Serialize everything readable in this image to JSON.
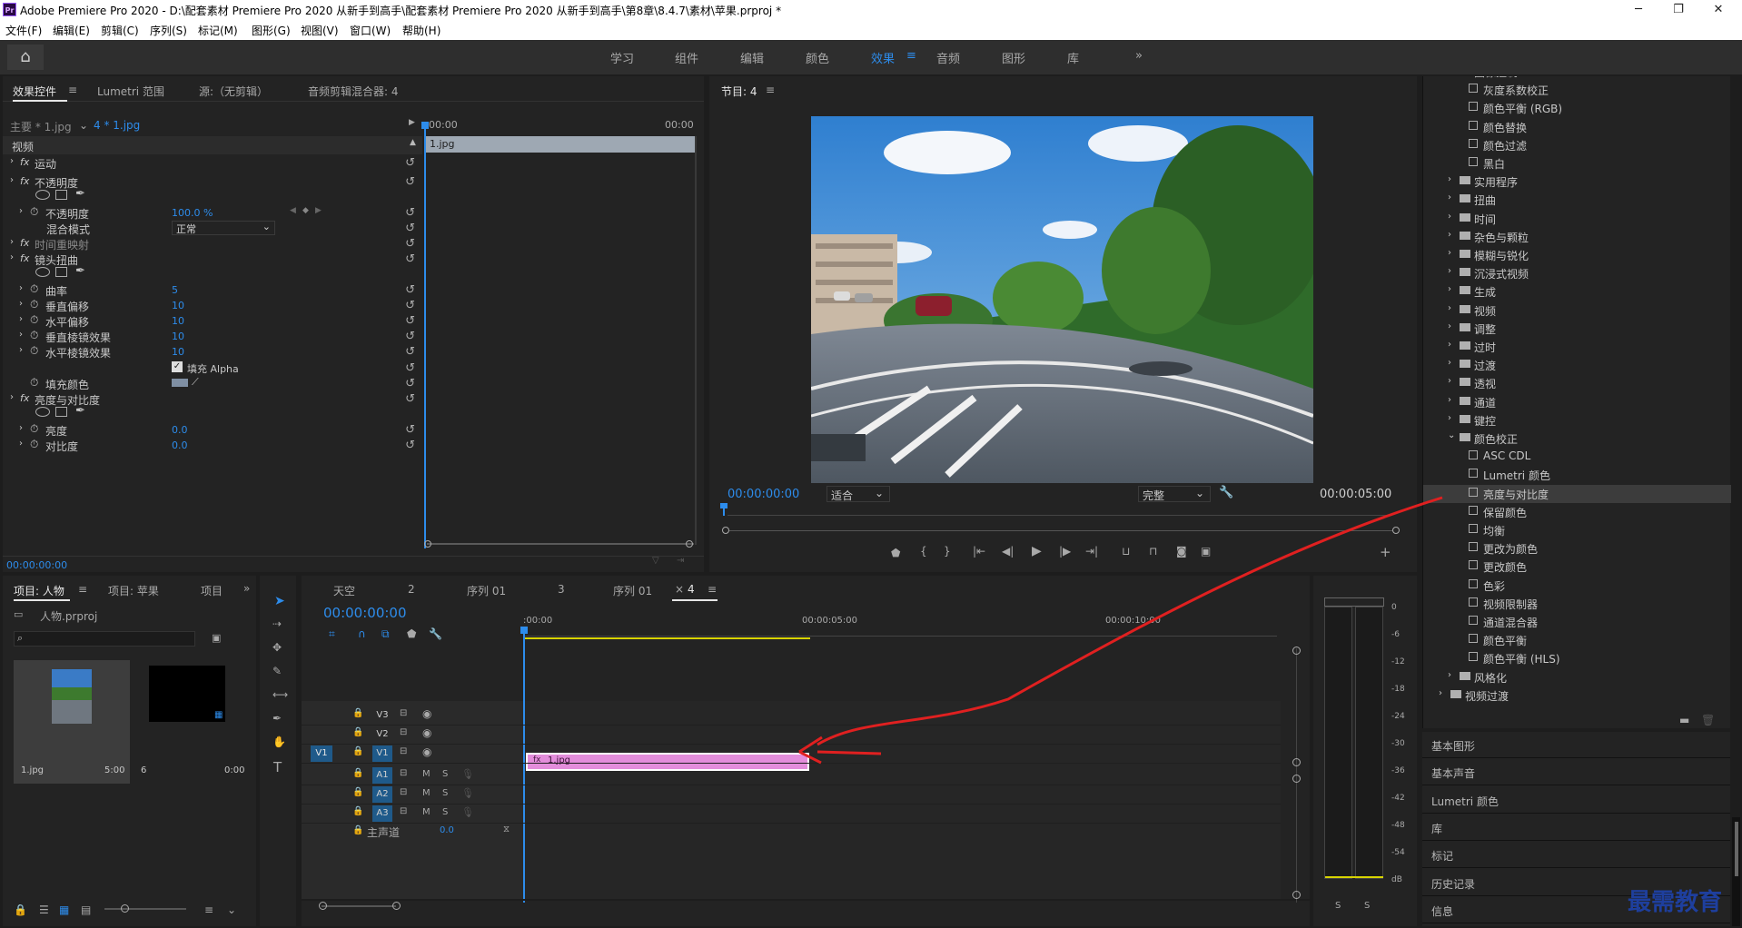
{
  "window": {
    "app_icon": "Pr",
    "title": "Adobe Premiere Pro 2020 - D:\\配套素材 Premiere Pro 2020 从新手到高手\\配套素材 Premiere Pro 2020 从新手到高手\\第8章\\8.4.7\\素材\\苹果.prproj *",
    "minimize": "─",
    "maximize": "❐",
    "close": "✕"
  },
  "menu": [
    "文件(F)",
    "编辑(E)",
    "剪辑(C)",
    "序列(S)",
    "标记(M)",
    "图形(G)",
    "视图(V)",
    "窗口(W)",
    "帮助(H)"
  ],
  "workspaces": [
    "学习",
    "组件",
    "编辑",
    "颜色",
    "效果",
    "音频",
    "图形",
    "库"
  ],
  "workspace_active": "效果",
  "accent": "#2d8ceb",
  "effect_controls": {
    "tabs": [
      "效果控件",
      "Lumetri 范围",
      "源:（无剪辑）",
      "音频剪辑混合器: 4"
    ],
    "master": "主要 * 1.jpg",
    "clip": "4 * 1.jpg",
    "time_start": "00:00",
    "time_end": "00:00",
    "clip_label": "1.jpg",
    "section": "视频",
    "rows": [
      {
        "label": "运动",
        "value": ""
      },
      {
        "label": "不透明度",
        "value": ""
      },
      {
        "label": "不透明度",
        "value": "100.0 %"
      },
      {
        "label": "混合模式",
        "value": "正常"
      },
      {
        "label": "时间重映射",
        "value": ""
      },
      {
        "label": "镜头扭曲",
        "value": ""
      },
      {
        "label": "曲率",
        "value": "5"
      },
      {
        "label": "垂直偏移",
        "value": "10"
      },
      {
        "label": "水平偏移",
        "value": "10"
      },
      {
        "label": "垂直棱镜效果",
        "value": "10"
      },
      {
        "label": "水平棱镜效果",
        "value": "10"
      },
      {
        "label": "填充 Alpha",
        "value": ""
      },
      {
        "label": "填充颜色",
        "value": ""
      },
      {
        "label": "亮度与对比度",
        "value": ""
      },
      {
        "label": "亮度",
        "value": "0.0"
      },
      {
        "label": "对比度",
        "value": "0.0"
      }
    ],
    "timecode": "00:00:00:00"
  },
  "program": {
    "title": "节目: 4",
    "timecode_left": "00:00:00:00",
    "fit": "适合",
    "quality": "完整",
    "timecode_right": "00:00:05:00"
  },
  "effects_tree": {
    "top_partial": "图像控制",
    "image_control_items": [
      "灰度系数校正",
      "颜色平衡 (RGB)",
      "颜色替换",
      "颜色过滤",
      "黑白"
    ],
    "folders": [
      "实用程序",
      "扭曲",
      "时间",
      "杂色与颗粒",
      "模糊与锐化",
      "沉浸式视频",
      "生成",
      "视频",
      "调整",
      "过时",
      "过渡",
      "透视",
      "通道",
      "键控",
      "颜色校正"
    ],
    "color_items": [
      "ASC CDL",
      "Lumetri 颜色",
      "亮度与对比度",
      "保留颜色",
      "均衡",
      "更改为颜色",
      "更改颜色",
      "色彩",
      "视频限制器",
      "通道混合器",
      "颜色平衡",
      "颜色平衡 (HLS)"
    ],
    "selected": "亮度与对比度",
    "after": [
      "风格化"
    ],
    "root": "视频过渡",
    "panels": [
      "基本图形",
      "基本声音",
      "Lumetri 颜色",
      "库",
      "标记",
      "历史记录",
      "信息"
    ]
  },
  "project": {
    "tabs": [
      "项目: 人物",
      "项目: 苹果",
      "项目"
    ],
    "file": "人物.prproj",
    "items": [
      {
        "name": "1.jpg",
        "duration": "5:00"
      },
      {
        "name": "6",
        "duration": "0:00"
      }
    ]
  },
  "timeline": {
    "tabs": [
      "天空",
      "2",
      "序列 01",
      "3",
      "序列 01",
      "4"
    ],
    "active_tab": "4",
    "timecode": "00:00:00:00",
    "ruler": [
      ":00:00",
      "00:00:05:00",
      "00:00:10:00"
    ],
    "video_tracks": [
      "V3",
      "V2",
      "V1"
    ],
    "audio_tracks": [
      "A1",
      "A2",
      "A3"
    ],
    "source_patch": "V1",
    "mute": "M",
    "solo": "S",
    "master": "主声道",
    "master_value": "0.0",
    "clip": "1.jpg",
    "clip_color": "#e38ddb"
  },
  "meter": {
    "scale": [
      "0",
      "-6",
      "-12",
      "-18",
      "-24",
      "-30",
      "-36",
      "-42",
      "-48",
      "-54",
      "dB"
    ],
    "solo_left": "S",
    "solo_right": "S"
  },
  "watermark": "最需教育"
}
